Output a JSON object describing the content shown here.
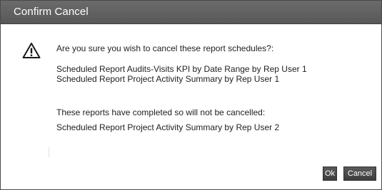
{
  "dialog": {
    "title": "Confirm Cancel",
    "icon": "warning-icon",
    "question": "Are you sure you wish to cancel these report schedules?:",
    "scheduled_items": [
      "Scheduled Report Audits-Visits KPI by Date Range by Rep User 1",
      "Scheduled Report Project Activity Summary by Rep User 1"
    ],
    "completed_header": "These reports have completed so will not be cancelled:",
    "completed_items": [
      "Scheduled Report Project Activity Summary by Rep User 2"
    ],
    "buttons": {
      "ok_label": "Ok",
      "cancel_label": "Cancel"
    }
  },
  "colors": {
    "titlebar": "#5f5f5f",
    "title_text": "#ffffff",
    "button": "#4a4a4a",
    "body_text": "#222222"
  }
}
